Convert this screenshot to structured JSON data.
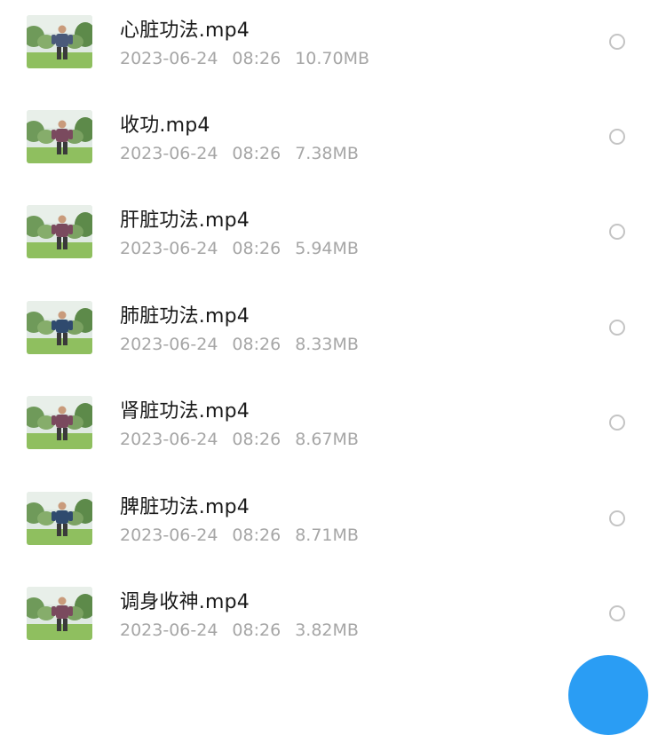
{
  "files": [
    {
      "name": "心脏功法.mp4",
      "date": "2023-06-24",
      "time": "08:26",
      "size": "10.70MB",
      "shirt": "#4a5a7a"
    },
    {
      "name": "收功.mp4",
      "date": "2023-06-24",
      "time": "08:26",
      "size": "7.38MB",
      "shirt": "#7a4a5e"
    },
    {
      "name": "肝脏功法.mp4",
      "date": "2023-06-24",
      "time": "08:26",
      "size": "5.94MB",
      "shirt": "#7a4a5e"
    },
    {
      "name": "肺脏功法.mp4",
      "date": "2023-06-24",
      "time": "08:26",
      "size": "8.33MB",
      "shirt": "#2f4a6e"
    },
    {
      "name": "肾脏功法.mp4",
      "date": "2023-06-24",
      "time": "08:26",
      "size": "8.67MB",
      "shirt": "#7a4a5e"
    },
    {
      "name": "脾脏功法.mp4",
      "date": "2023-06-24",
      "time": "08:26",
      "size": "8.71MB",
      "shirt": "#2f4a6e"
    },
    {
      "name": "调身收神.mp4",
      "date": "2023-06-24",
      "time": "08:26",
      "size": "3.82MB",
      "shirt": "#7a4a5e"
    }
  ],
  "colors": {
    "accent": "#2a9df4",
    "title_text": "#1a1a1a",
    "meta_text": "#a6a6a6",
    "radio_border": "#c4c4c4"
  },
  "icons": {
    "thumbnail": "video-thumbnail",
    "select": "radio-circle-icon"
  }
}
